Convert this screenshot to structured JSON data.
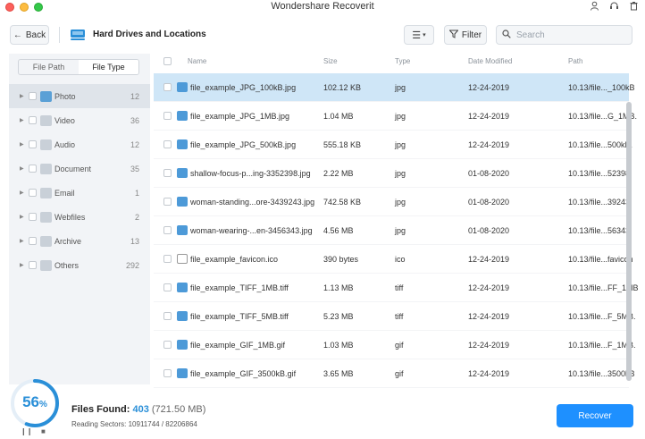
{
  "app": {
    "title": "Wondershare Recoverit"
  },
  "toolbar": {
    "back_label": "Back",
    "location_title": "Hard Drives and Locations",
    "filter_label": "Filter",
    "search_placeholder": "Search",
    "search_value": ""
  },
  "sidebar": {
    "tabs": [
      {
        "label": "File Path",
        "active": false
      },
      {
        "label": "File Type",
        "active": true
      }
    ],
    "categories": [
      {
        "name": "Photo",
        "count": "12",
        "selected": true,
        "icon": "photo-icon"
      },
      {
        "name": "Video",
        "count": "36",
        "selected": false,
        "icon": "video-icon"
      },
      {
        "name": "Audio",
        "count": "12",
        "selected": false,
        "icon": "audio-icon"
      },
      {
        "name": "Document",
        "count": "35",
        "selected": false,
        "icon": "document-icon"
      },
      {
        "name": "Email",
        "count": "1",
        "selected": false,
        "icon": "email-icon"
      },
      {
        "name": "Webfiles",
        "count": "2",
        "selected": false,
        "icon": "webfiles-icon"
      },
      {
        "name": "Archive",
        "count": "13",
        "selected": false,
        "icon": "archive-icon"
      },
      {
        "name": "Others",
        "count": "292",
        "selected": false,
        "icon": "others-icon"
      }
    ]
  },
  "table": {
    "columns": {
      "name": "Name",
      "size": "Size",
      "type": "Type",
      "date": "Date Modified",
      "path": "Path"
    },
    "rows": [
      {
        "name": "file_example_JPG_100kB.jpg",
        "size": "102.12 KB",
        "type": "jpg",
        "date": "12-24-2019",
        "path": "10.13/file..._100kB",
        "selected": true,
        "icon": "image-file-icon"
      },
      {
        "name": "file_example_JPG_1MB.jpg",
        "size": "1.04 MB",
        "type": "jpg",
        "date": "12-24-2019",
        "path": "10.13/file...G_1MB.",
        "selected": false,
        "icon": "image-file-icon"
      },
      {
        "name": "file_example_JPG_500kB.jpg",
        "size": "555.18 KB",
        "type": "jpg",
        "date": "12-24-2019",
        "path": "10.13/file...500kB.",
        "selected": false,
        "icon": "image-file-icon"
      },
      {
        "name": "shallow-focus-p...ing-3352398.jpg",
        "size": "2.22 MB",
        "type": "jpg",
        "date": "01-08-2020",
        "path": "10.13/file...52398.",
        "selected": false,
        "icon": "image-file-icon"
      },
      {
        "name": "woman-standing...ore-3439243.jpg",
        "size": "742.58 KB",
        "type": "jpg",
        "date": "01-08-2020",
        "path": "10.13/file...39243.",
        "selected": false,
        "icon": "image-file-icon"
      },
      {
        "name": "woman-wearing-...en-3456343.jpg",
        "size": "4.56 MB",
        "type": "jpg",
        "date": "01-08-2020",
        "path": "10.13/file...56343.",
        "selected": false,
        "icon": "image-file-icon"
      },
      {
        "name": "file_example_favicon.ico",
        "size": "390 bytes",
        "type": "ico",
        "date": "12-24-2019",
        "path": "10.13/file...favicon",
        "selected": false,
        "icon": "generic-file-icon"
      },
      {
        "name": "file_example_TIFF_1MB.tiff",
        "size": "1.13 MB",
        "type": "tiff",
        "date": "12-24-2019",
        "path": "10.13/file...FF_1MB",
        "selected": false,
        "icon": "image-file-icon"
      },
      {
        "name": "file_example_TIFF_5MB.tiff",
        "size": "5.23 MB",
        "type": "tiff",
        "date": "12-24-2019",
        "path": "10.13/file...F_5MB.",
        "selected": false,
        "icon": "image-file-icon"
      },
      {
        "name": "file_example_GIF_1MB.gif",
        "size": "1.03 MB",
        "type": "gif",
        "date": "12-24-2019",
        "path": "10.13/file...F_1MB.",
        "selected": false,
        "icon": "image-file-icon"
      },
      {
        "name": "file_example_GIF_3500kB.gif",
        "size": "3.65 MB",
        "type": "gif",
        "date": "12-24-2019",
        "path": "10.13/file...3500kB",
        "selected": false,
        "icon": "image-file-icon"
      }
    ]
  },
  "footer": {
    "progress_value": "56",
    "progress_unit": "%",
    "progress_fraction": 0.56,
    "files_found_label": "Files Found:",
    "files_found_count": "403",
    "files_found_size": "(721.50 MB)",
    "reading_sectors": "Reading Sectors: 10911744 / 82206864",
    "recover_label": "Recover"
  },
  "colors": {
    "accent": "#1e90ff",
    "selection": "#cfe6f7",
    "progress": "#2a8fd8"
  }
}
